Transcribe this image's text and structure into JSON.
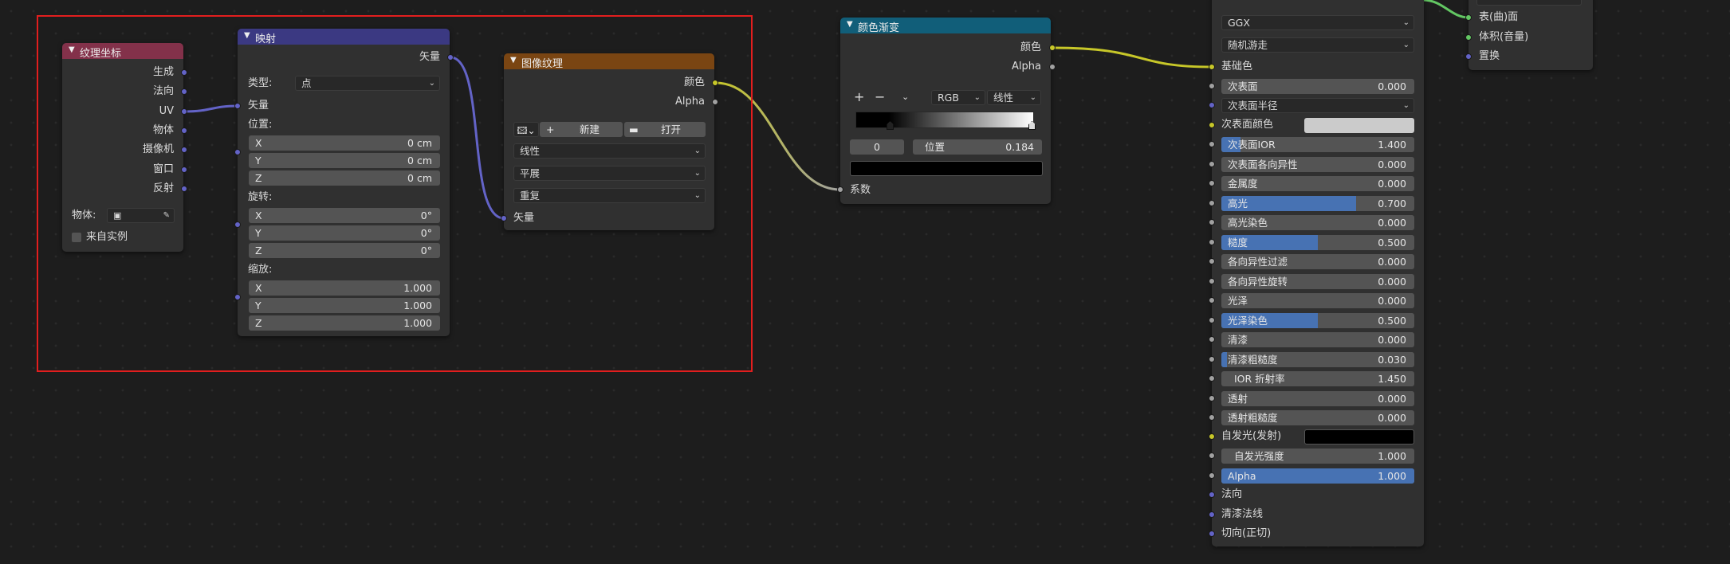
{
  "colors": {
    "vector_socket": "#6363c7",
    "color_socket": "#c7c729",
    "float_socket": "#a1a1a1",
    "shader_socket": "#63c763",
    "texcoord_header": "#83314a",
    "mapping_header": "#3b3982",
    "imagetex_header": "#7a4512",
    "colorramp_header": "#115e79",
    "selection_box": "#e21e1e",
    "slider_fill": "#4772b3"
  },
  "texcoord": {
    "title": "纹理坐标",
    "outputs": [
      "生成",
      "法向",
      "UV",
      "物体",
      "摄像机",
      "窗口",
      "反射"
    ],
    "object_label": "物体:",
    "from_instancer": "来自实例"
  },
  "mapping": {
    "title": "映射",
    "output": "矢量",
    "type_label": "类型:",
    "type_value": "点",
    "input_vector": "矢量",
    "location_label": "位置:",
    "location": [
      {
        "axis": "X",
        "value": "0 cm"
      },
      {
        "axis": "Y",
        "value": "0 cm"
      },
      {
        "axis": "Z",
        "value": "0 cm"
      }
    ],
    "rotation_label": "旋转:",
    "rotation": [
      {
        "axis": "X",
        "value": "0°"
      },
      {
        "axis": "Y",
        "value": "0°"
      },
      {
        "axis": "Z",
        "value": "0°"
      }
    ],
    "scale_label": "缩放:",
    "scale": [
      {
        "axis": "X",
        "value": "1.000"
      },
      {
        "axis": "Y",
        "value": "1.000"
      },
      {
        "axis": "Z",
        "value": "1.000"
      }
    ]
  },
  "image_texture": {
    "title": "图像纹理",
    "output_color": "颜色",
    "output_alpha": "Alpha",
    "new_label": "新建",
    "open_label": "打开",
    "interpolation": "线性",
    "projection": "平展",
    "extension": "重复",
    "input_vector": "矢量"
  },
  "color_ramp": {
    "title": "颜色渐变",
    "output_color": "颜色",
    "output_alpha": "Alpha",
    "add": "+",
    "remove": "−",
    "color_mode": "RGB",
    "interpolation": "线性",
    "stop_index": "0",
    "position_label": "位置",
    "position_value": "0.184",
    "input_fac": "系数"
  },
  "principled": {
    "distribution": "GGX",
    "subsurface_method": "随机游走",
    "base_color": "基础色",
    "subsurface_label": "次表面",
    "subsurface_value": "0.000",
    "subsurface_radius": "次表面半径",
    "subsurface_color": "次表面颜色",
    "rows": [
      {
        "label": "次表面IOR",
        "value": "1.400",
        "fill": 0.1
      },
      {
        "label": "次表面各向异性",
        "value": "0.000",
        "fill": 0
      },
      {
        "label": "金属度",
        "value": "0.000",
        "fill": 0
      },
      {
        "label": "高光",
        "value": "0.700",
        "fill": 0.7
      },
      {
        "label": "高光染色",
        "value": "0.000",
        "fill": 0
      },
      {
        "label": "糙度",
        "value": "0.500",
        "fill": 0.5
      },
      {
        "label": "各向异性过滤",
        "value": "0.000",
        "fill": 0
      },
      {
        "label": "各向异性旋转",
        "value": "0.000",
        "fill": 0
      },
      {
        "label": "光泽",
        "value": "0.000",
        "fill": 0
      },
      {
        "label": "光泽染色",
        "value": "0.500",
        "fill": 0.5
      },
      {
        "label": "清漆",
        "value": "0.000",
        "fill": 0
      },
      {
        "label": "清漆粗糙度",
        "value": "0.030",
        "fill": 0.03
      },
      {
        "label": "IOR 折射率",
        "value": "1.450",
        "fill": 0
      },
      {
        "label": "透射",
        "value": "0.000",
        "fill": 0
      },
      {
        "label": "透射粗糙度",
        "value": "0.000",
        "fill": 0
      }
    ],
    "emission": "自发光(发射)",
    "emission_strength_label": "自发光强度",
    "emission_strength_value": "1.000",
    "alpha_label": "Alpha",
    "alpha_value": "1.000",
    "alpha_fill": 1.0,
    "normal": "法向",
    "clearcoat_normal": "清漆法线",
    "tangent": "切向(正切)"
  },
  "output": {
    "surface": "表(曲)面",
    "volume": "体积(音量)",
    "displacement": "置换"
  }
}
